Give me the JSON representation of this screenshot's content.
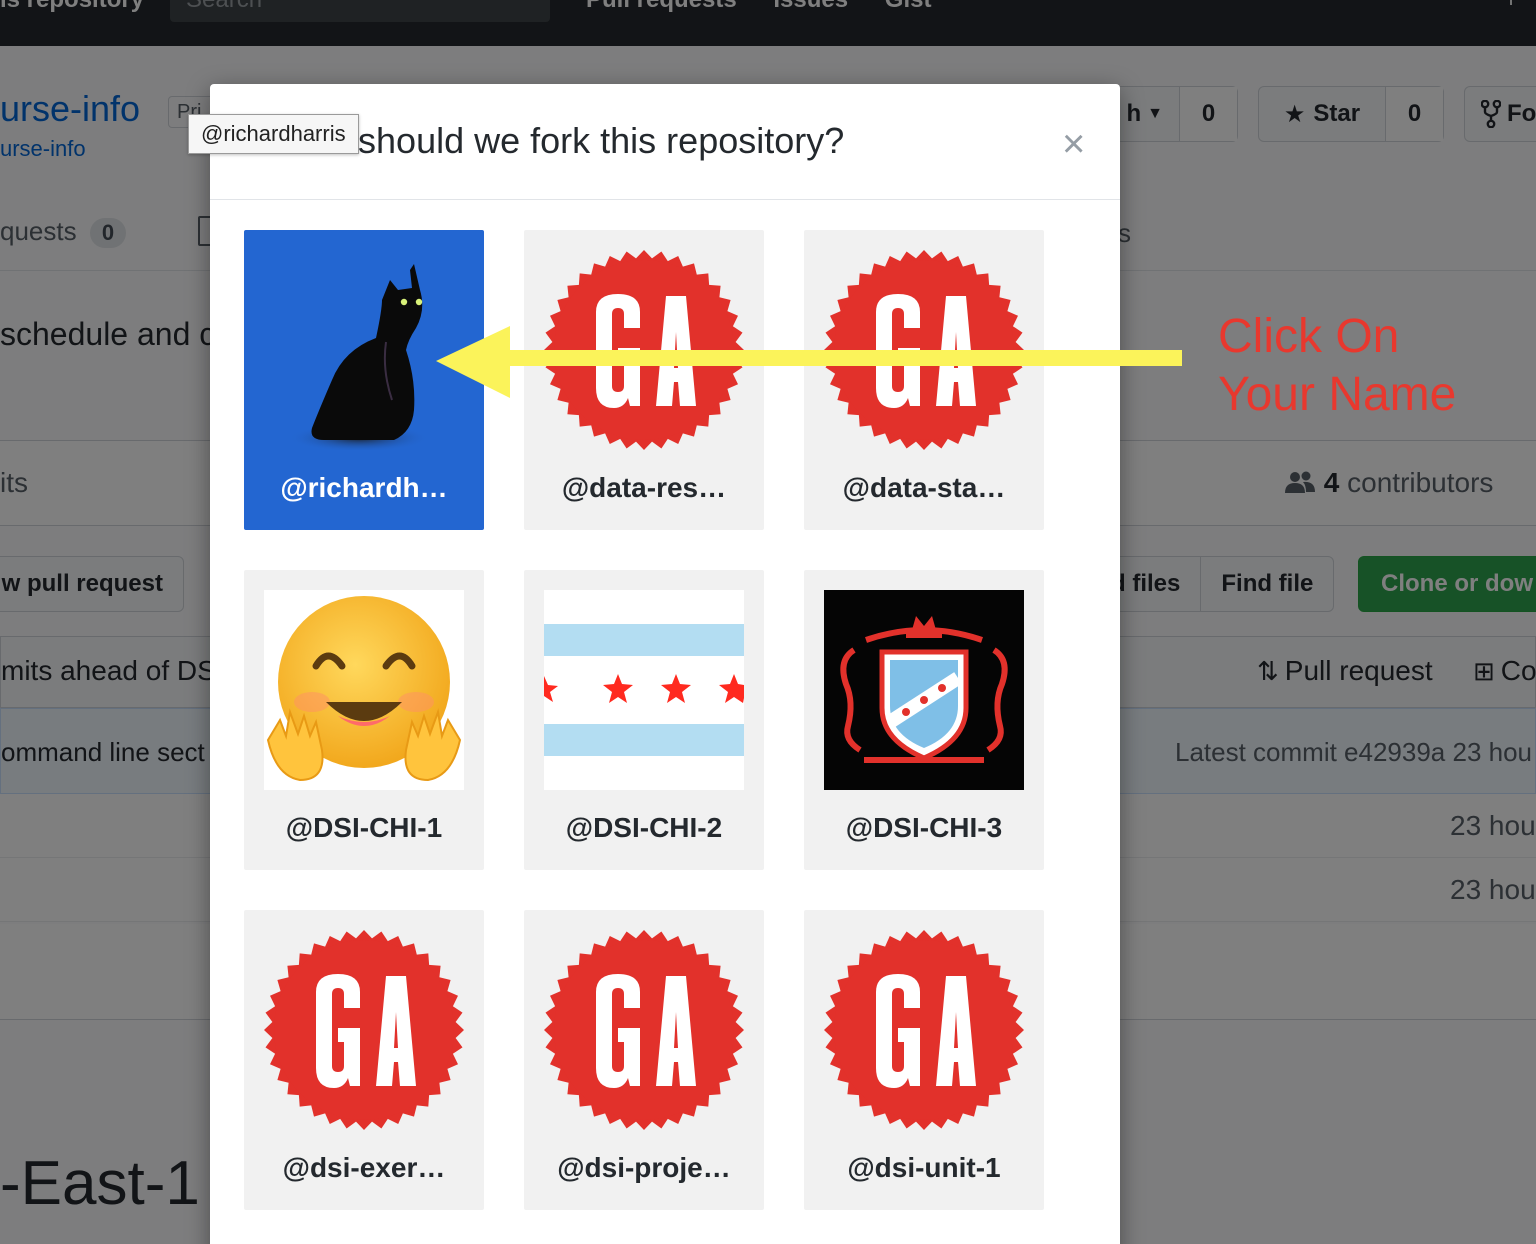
{
  "header": {
    "scope_label": "is repository",
    "search_placeholder": "Search",
    "nav_links": [
      "Pull requests",
      "Issues",
      "Gist"
    ],
    "plus": "+"
  },
  "repo": {
    "name": "urse-info",
    "private_badge": "Pri",
    "forked_from": "urse-info",
    "branch_button": "h",
    "watch_count": "0",
    "star_label": "Star",
    "star_count": "0",
    "fork_label": "Fo"
  },
  "tabs": {
    "pull_requests": "quests",
    "pull_requests_count": "0",
    "trailing": "s"
  },
  "description": "schedule and c",
  "numbers": {
    "commits": "its",
    "contributors_count": "4",
    "contributors_label": "contributors"
  },
  "actions": {
    "new_pull_request": "w pull request",
    "upload_files": "d files",
    "find_file": "Find file",
    "clone": "Clone or dow"
  },
  "ahead": {
    "text": "mits ahead of DS",
    "pull_request": "Pull request",
    "compare": "Co"
  },
  "commit": {
    "message": "ommand line sect",
    "latest": "Latest commit e42939a 23 hou"
  },
  "file_rows": [
    {
      "age": "23 hou"
    },
    {
      "age": "23 hou"
    }
  ],
  "readme_heading": "-East-1",
  "modal": {
    "title": "Where should we fork this repository?",
    "close": "×",
    "owners": [
      {
        "name": "@richardh…",
        "avatar": "black-cat",
        "selected": true
      },
      {
        "name": "@data-res…",
        "avatar": "ga-logo"
      },
      {
        "name": "@data-sta…",
        "avatar": "ga-logo"
      },
      {
        "name": "@DSI-CHI-1",
        "avatar": "hugging-emoji"
      },
      {
        "name": "@DSI-CHI-2",
        "avatar": "chicago-flag"
      },
      {
        "name": "@DSI-CHI-3",
        "avatar": "crest"
      },
      {
        "name": "@dsi-exer…",
        "avatar": "ga-logo"
      },
      {
        "name": "@dsi-proje…",
        "avatar": "ga-logo"
      },
      {
        "name": "@dsi-unit-1",
        "avatar": "ga-logo"
      }
    ],
    "tooltip": "@richardharris"
  },
  "annotation": {
    "line1": "Click On",
    "line2": "Your Name",
    "color": "#e8382e",
    "arrow_color": "#fbf35a"
  },
  "colors": {
    "selected_card": "#2366d1",
    "ga_red": "#e2312b",
    "clone_green": "#2ea44f"
  }
}
